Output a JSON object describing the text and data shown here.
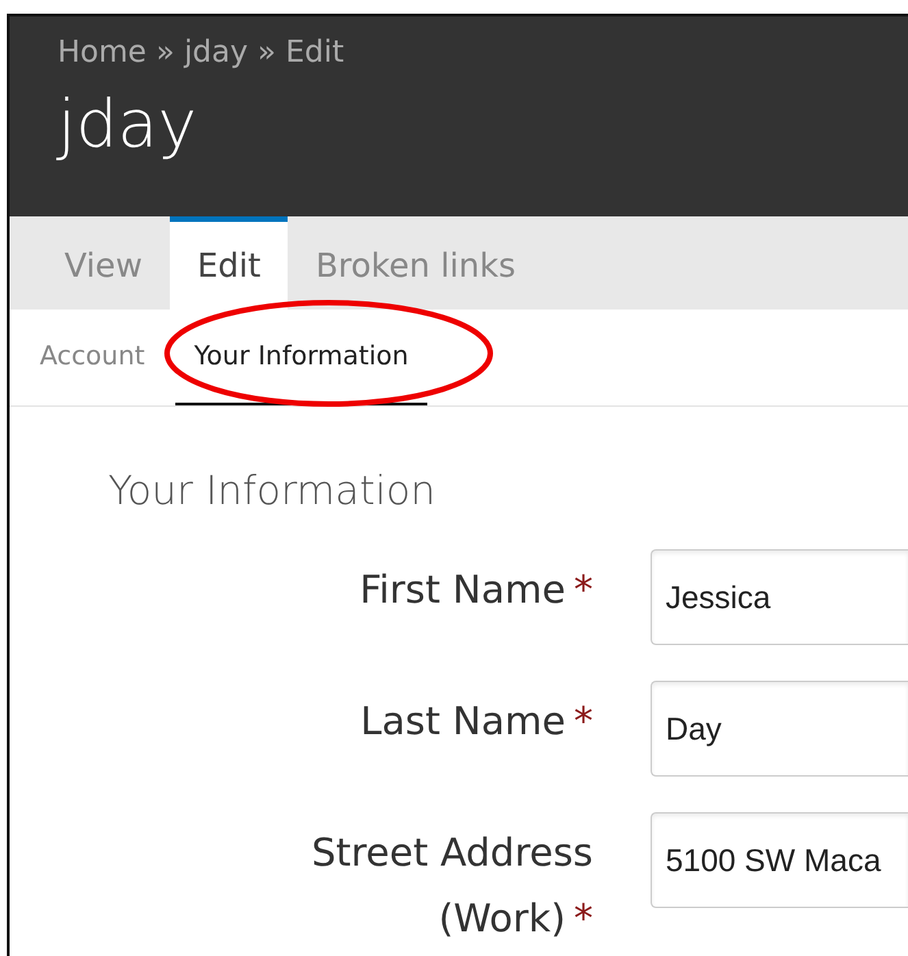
{
  "breadcrumb": [
    "Home",
    "»",
    "jday",
    "»",
    "Edit"
  ],
  "page_title": "jday",
  "tabs": [
    {
      "label": "View",
      "selected": false
    },
    {
      "label": "Edit",
      "selected": true
    },
    {
      "label": "Broken links",
      "selected": false
    }
  ],
  "subtabs": [
    {
      "label": "Account",
      "selected": false
    },
    {
      "label": "Your Information",
      "selected": true
    }
  ],
  "annotations": [
    {
      "kind": "ellipse",
      "color": "#ee0000"
    }
  ],
  "form": {
    "heading": "Your Information",
    "fields": [
      {
        "label": "First Name",
        "required_mark": "*",
        "value": "Jessica"
      },
      {
        "label": "Last Name",
        "required_mark": "*",
        "value": "Day"
      },
      {
        "label": "Street Address (Work)",
        "required_mark": "*",
        "value": "5100 SW Maca"
      }
    ]
  }
}
